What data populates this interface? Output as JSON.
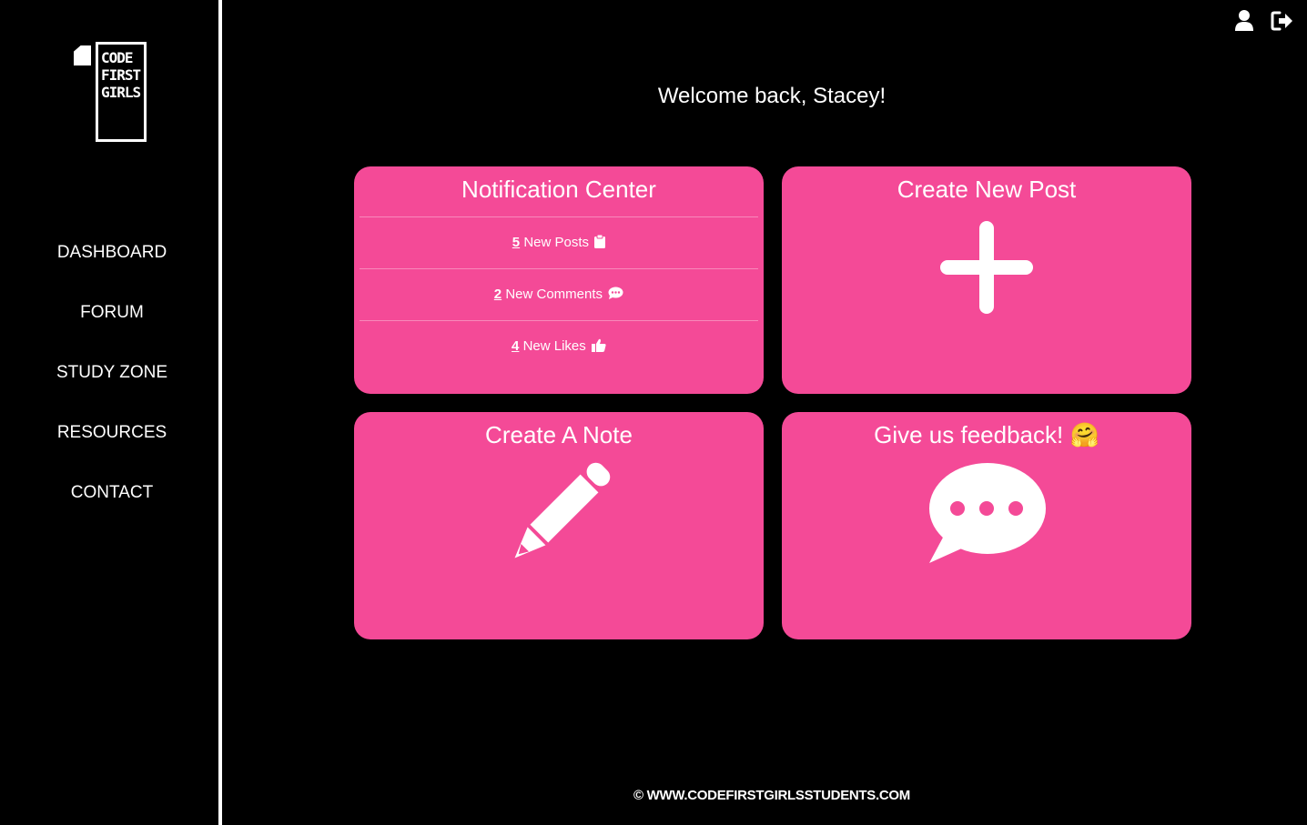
{
  "brand": {
    "logo_lines": [
      "CODE",
      "FIRST",
      "GIRLS"
    ]
  },
  "sidebar": {
    "items": [
      {
        "label": "DASHBOARD"
      },
      {
        "label": "FORUM"
      },
      {
        "label": "STUDY ZONE"
      },
      {
        "label": "RESOURCES"
      },
      {
        "label": "CONTACT"
      }
    ]
  },
  "header": {
    "icons": [
      "user-icon",
      "sign-out-icon"
    ]
  },
  "main": {
    "welcome": "Welcome back, Stacey!",
    "cards": {
      "notifications": {
        "title": "Notification Center",
        "rows": [
          {
            "count": "5",
            "label": "New Posts",
            "icon": "clipboard-icon"
          },
          {
            "count": "2",
            "label": "New Comments",
            "icon": "comment-dots-icon"
          },
          {
            "count": "4",
            "label": "New Likes",
            "icon": "thumbs-up-icon"
          }
        ]
      },
      "create_post": {
        "title": "Create New Post",
        "icon": "plus-icon"
      },
      "create_note": {
        "title": "Create A Note",
        "icon": "pencil-icon"
      },
      "feedback": {
        "title": "Give us feedback!",
        "emoji": "🤗",
        "icon": "comment-dots-icon"
      }
    }
  },
  "footer": {
    "text": "© WWW.CODEFIRSTGIRLSSTUDENTS.COM"
  },
  "colors": {
    "background": "#000000",
    "card": "#f44a97",
    "text": "#ffffff"
  }
}
